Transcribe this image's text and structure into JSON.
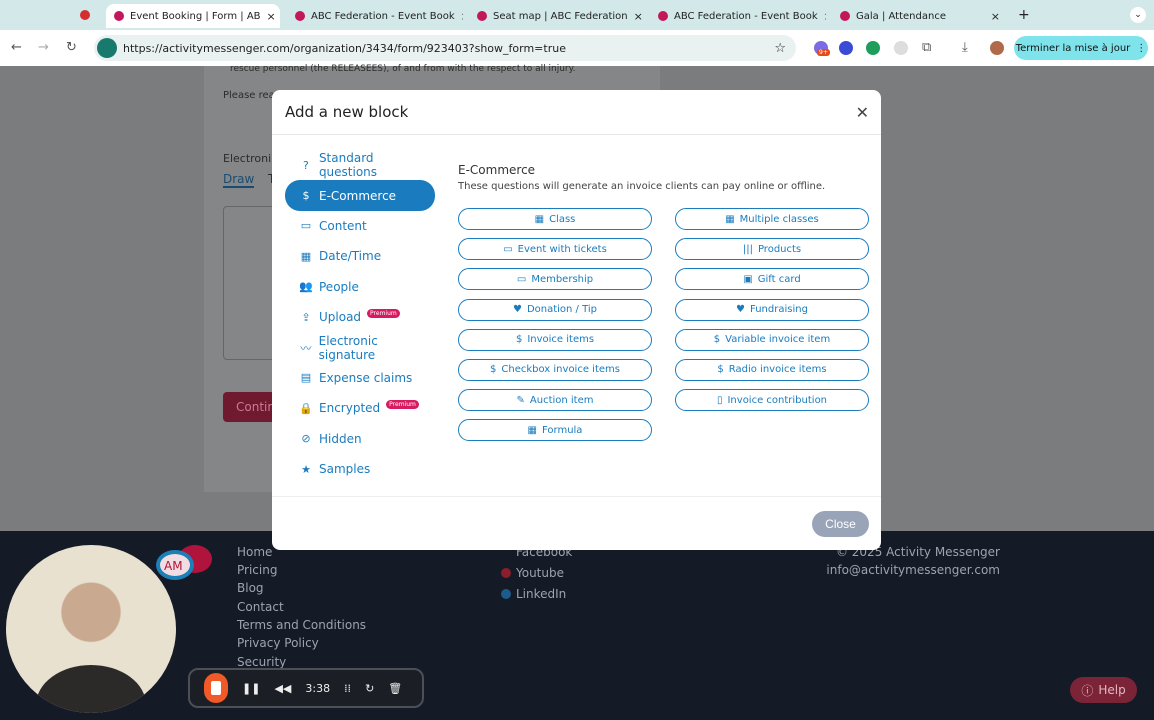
{
  "browser": {
    "tabs": [
      {
        "title": "Event Booking | Form | AB"
      },
      {
        "title": "ABC Federation - Event Book"
      },
      {
        "title": "Seat map | ABC Federation"
      },
      {
        "title": "ABC Federation - Event Book"
      },
      {
        "title": "Gala | Attendance"
      }
    ],
    "url": "https://activitymessenger.com/organization/3434/form/923403?show_form=true",
    "ext_badge": "9+",
    "update_label": "Terminer la mise à jour"
  },
  "background_form": {
    "line1": "rescue personnel (the RELEASEES), of and from with the respect to all injury.",
    "line2": "Please rea",
    "sig_label": "Electroni",
    "tab_draw": "Draw",
    "tab_type": "T",
    "continue": "Contin"
  },
  "modal": {
    "title": "Add a new block",
    "section_title": "E-Commerce",
    "section_desc": "These questions will generate an invoice clients can pay online or offline.",
    "close_label": "Close",
    "categories": [
      {
        "label": "Standard questions",
        "icon": "?"
      },
      {
        "label": "E-Commerce",
        "icon": "$"
      },
      {
        "label": "Content",
        "icon": "▭"
      },
      {
        "label": "Date/Time",
        "icon": "▦"
      },
      {
        "label": "People",
        "icon": "👥"
      },
      {
        "label": "Upload",
        "icon": "⇪",
        "badge": "Premium"
      },
      {
        "label": "Electronic signature",
        "icon": "〰"
      },
      {
        "label": "Expense claims",
        "icon": "▤"
      },
      {
        "label": "Encrypted",
        "icon": "🔒",
        "badge": "Premium"
      },
      {
        "label": "Hidden",
        "icon": "⊘"
      },
      {
        "label": "Samples",
        "icon": "★"
      }
    ],
    "blocks": [
      {
        "label": "Class",
        "icon": "▦"
      },
      {
        "label": "Multiple classes",
        "icon": "▦"
      },
      {
        "label": "Event with tickets",
        "icon": "▭"
      },
      {
        "label": "Products",
        "icon": "|||"
      },
      {
        "label": "Membership",
        "icon": "▭"
      },
      {
        "label": "Gift card",
        "icon": "▣"
      },
      {
        "label": "Donation / Tip",
        "icon": "♥"
      },
      {
        "label": "Fundraising",
        "icon": "♥"
      },
      {
        "label": "Invoice items",
        "icon": "$"
      },
      {
        "label": "Variable invoice item",
        "icon": "$"
      },
      {
        "label": "Checkbox invoice items",
        "icon": "$"
      },
      {
        "label": "Radio invoice items",
        "icon": "$"
      },
      {
        "label": "Auction item",
        "icon": "✎"
      },
      {
        "label": "Invoice contribution",
        "icon": "▯"
      },
      {
        "label": "Formula",
        "icon": "▦"
      }
    ]
  },
  "footer": {
    "links": [
      "Home",
      "Pricing",
      "Blog",
      "Contact",
      "Terms and Conditions",
      "Privacy Policy",
      "Security"
    ],
    "social": [
      "Facebook",
      "Youtube",
      "LinkedIn"
    ],
    "copyright": "© 2025 Activity Messenger",
    "email": "info@activitymessenger.com",
    "logo": "AM",
    "help": "Help"
  },
  "recorder": {
    "time": "3:38"
  }
}
